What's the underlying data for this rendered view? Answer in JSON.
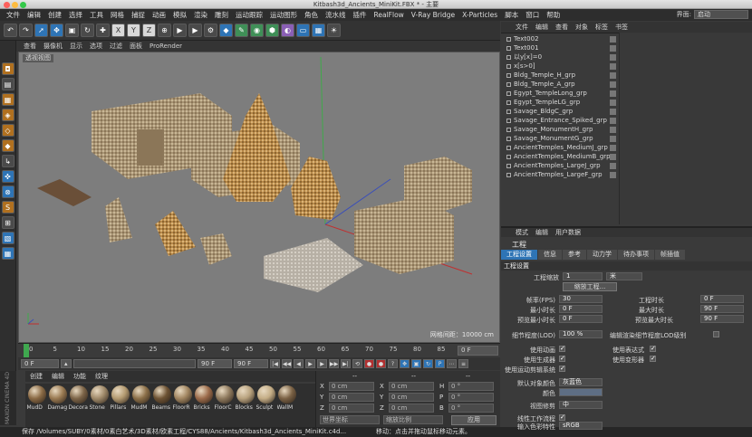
{
  "window": {
    "title": "Kitbash3d_Ancients_MiniKit.FBX * - 主要"
  },
  "menubar": [
    "文件",
    "编辑",
    "创建",
    "选择",
    "工具",
    "网格",
    "捕捉",
    "动画",
    "模拟",
    "渲染",
    "雕刻",
    "运动跟踪",
    "运动图形",
    "角色",
    "流水线",
    "插件",
    "RealFlow",
    "V-Ray Bridge",
    "X-Particles",
    "脚本",
    "窗口",
    "帮助"
  ],
  "layout": {
    "label": "界面:",
    "value": "启动"
  },
  "viewport_menu": [
    "查看",
    "摄像机",
    "显示",
    "选项",
    "过滤",
    "面板",
    "ProRender"
  ],
  "viewport": {
    "label": "透视视图",
    "grid": "网格间距：10000 cm"
  },
  "timeline": {
    "ticks": [
      "0",
      "5",
      "10",
      "15",
      "20",
      "25",
      "30",
      "35",
      "40",
      "45",
      "50",
      "55",
      "60",
      "65",
      "70",
      "75",
      "80",
      "85",
      "90"
    ],
    "end": "0 F"
  },
  "transport": {
    "start": "0 F",
    "current": "0 F",
    "max": "90 F",
    "end": "90 F"
  },
  "material_menu": [
    "创建",
    "编辑",
    "功能",
    "纹理"
  ],
  "materials": [
    {
      "name": "MudD",
      "color": "#8a6a45"
    },
    {
      "name": "Damag",
      "color": "#9a7a52"
    },
    {
      "name": "Decora",
      "color": "#7d6548"
    },
    {
      "name": "Stone",
      "color": "#a08a6a"
    },
    {
      "name": "Pillars",
      "color": "#b39a70"
    },
    {
      "name": "MudM",
      "color": "#8c7049"
    },
    {
      "name": "Beams",
      "color": "#6e5334"
    },
    {
      "name": "FloorR",
      "color": "#a18560"
    },
    {
      "name": "Bricks",
      "color": "#9c6b4a"
    },
    {
      "name": "FloorC",
      "color": "#8f7a5e"
    },
    {
      "name": "Blocks",
      "color": "#b8a27e"
    },
    {
      "name": "Sculpt",
      "color": "#c4ad86"
    },
    {
      "name": "WallM",
      "color": "#7b6245"
    }
  ],
  "maxon": "MAXON CINEMA 4D",
  "coords": {
    "header": "--",
    "header2": "--",
    "header3": "--",
    "rows": [
      {
        "a": "X",
        "av": "0 cm",
        "b": "X",
        "bv": "0 cm",
        "c": "H",
        "cv": "0 °"
      },
      {
        "a": "Y",
        "av": "0 cm",
        "b": "Y",
        "bv": "0 cm",
        "c": "P",
        "cv": "0 °"
      },
      {
        "a": "Z",
        "av": "0 cm",
        "b": "Z",
        "bv": "0 cm",
        "c": "B",
        "cv": "0 °"
      }
    ],
    "mode1": "世界坐标",
    "mode2": "缩放比例",
    "apply": "应用"
  },
  "status": "保存 /Volumes/SUBY/0素材/0素白艺术/3D素材/欧素工程/CYS88/Ancients/Kitbash3d_Ancients_MiniKit.c4d...",
  "status_right": "移动：点击并拖动鼠标移动元素。",
  "object_menu": [
    "文件",
    "编辑",
    "查看",
    "对象",
    "标签",
    "书签"
  ],
  "objects": [
    "Text002",
    "Text001",
    "以y[x]=0",
    "x[s>0]",
    "Bldg_Temple_H_grp",
    "Bldg_Temple_A_grp",
    "Egypt_TempleLong_grp",
    "Egypt_TempleLG_grp",
    "Savage_BldgC_grp",
    "Savage_Entrance_Spiked_grp",
    "Savage_MonumentH_grp",
    "Savage_MonumentG_grp",
    "AncientTemples_MediumJ_grp",
    "AncientTemples_MediumB_grp",
    "AncientTemples_LargeJ_grp",
    "AncientTemples_LargeF_grp"
  ],
  "attr_menu": [
    "模式",
    "编辑",
    "用户数据"
  ],
  "attr": {
    "title": "工程",
    "tabs": [
      "工程设置",
      "信息",
      "参考",
      "动力学",
      "待办事项",
      "帧插值"
    ],
    "section": "工程设置",
    "scale_label": "工程缩放",
    "scale_value": "1",
    "scale_unit": "米",
    "scale_btn": "缩放工程...",
    "fps_label": "帧率(FPS)",
    "fps": "30",
    "mintime_label": "最小时长",
    "mintime": "0 F",
    "previewmin_label": "预览最小时长",
    "previewmin": "0 F",
    "duration_label": "工程时长",
    "duration": "0 F",
    "maxtime_label": "最大时长",
    "maxtime": "90 F",
    "previewmax_label": "预览最大时长",
    "previewmax": "90 F",
    "lod_label": "细节程度(LOD)",
    "lod": "100 %",
    "lod_render": "编辑渲染细节程度LOD级别",
    "anim_label": "使用动画",
    "expr_label": "使用表达式",
    "gen_label": "使用生成器",
    "deform_label": "使用变形器",
    "motion_label": "使用运动剪辑系统",
    "defcolor_label": "默认对象颜色",
    "defcolor": "灰蓝色",
    "color_label": "颜色",
    "viewcorr_label": "视图修剪",
    "viewcorr": "中",
    "linear_label": "线性工作流程",
    "input_label": "输入色彩特性",
    "input": "sRGB"
  }
}
